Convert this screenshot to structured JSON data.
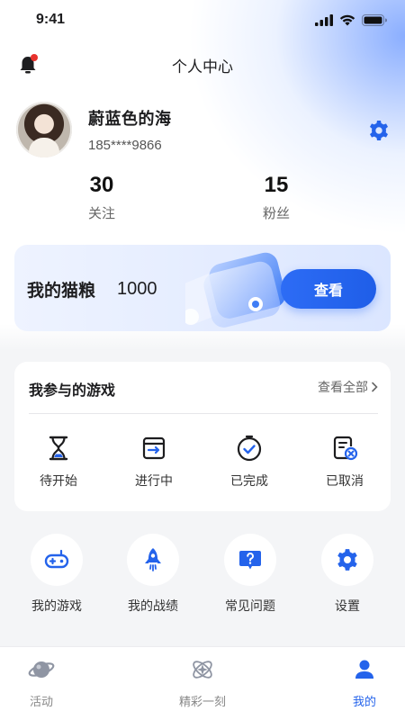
{
  "status_bar": {
    "time": "9:41"
  },
  "header": {
    "title": "个人中心"
  },
  "profile": {
    "name": "蔚蓝色的海",
    "phone": "185****9866"
  },
  "stats": [
    {
      "value": "30",
      "label": "关注"
    },
    {
      "value": "15",
      "label": "粉丝"
    }
  ],
  "cat_food": {
    "label": "我的猫粮",
    "value": "1000",
    "button": "查看"
  },
  "games": {
    "title": "我参与的游戏",
    "view_all": "查看全部",
    "statuses": [
      {
        "label": "待开始",
        "icon": "hourglass-icon"
      },
      {
        "label": "进行中",
        "icon": "in-progress-icon"
      },
      {
        "label": "已完成",
        "icon": "completed-icon"
      },
      {
        "label": "已取消",
        "icon": "cancelled-icon"
      }
    ]
  },
  "quick_actions": [
    {
      "label": "我的游戏",
      "icon": "gamepad-icon"
    },
    {
      "label": "我的战绩",
      "icon": "rocket-icon"
    },
    {
      "label": "常见问题",
      "icon": "question-icon"
    },
    {
      "label": "设置",
      "icon": "gear-icon"
    }
  ],
  "tab_bar": {
    "active": "我的",
    "items": [
      {
        "label": "活动",
        "icon": "planet-icon"
      },
      {
        "label": "精彩一刻",
        "icon": "sparkle-icon"
      },
      {
        "label": "我的",
        "icon": "user-icon"
      }
    ]
  },
  "colors": {
    "accent": "#2463eb",
    "badge": "#e8322d"
  }
}
